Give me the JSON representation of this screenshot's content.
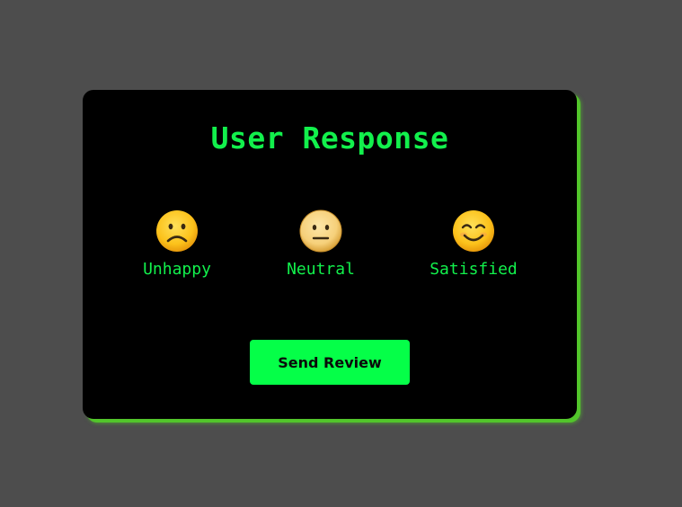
{
  "card": {
    "title": "User Response"
  },
  "ratings": [
    {
      "label": "Unhappy",
      "icon": "sad-face-icon"
    },
    {
      "label": "Neutral",
      "icon": "neutral-face-icon"
    },
    {
      "label": "Satisfied",
      "icon": "smiling-face-icon"
    }
  ],
  "actions": {
    "send_label": "Send Review"
  },
  "colors": {
    "background": "#4d4d4d",
    "card": "#000000",
    "accent": "#12f04c",
    "button": "#05ff48",
    "shadow": "#52c52b",
    "emoji": "#fcc21b"
  }
}
